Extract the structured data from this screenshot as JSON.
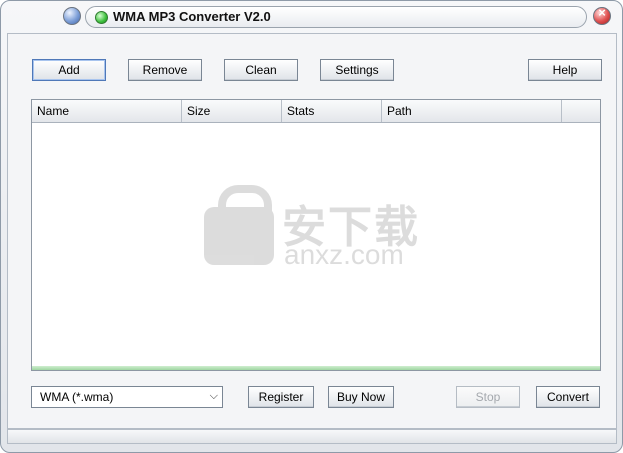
{
  "window": {
    "title": "WMA MP3 Converter V2.0"
  },
  "toolbar": {
    "add_label": "Add",
    "remove_label": "Remove",
    "clean_label": "Clean",
    "settings_label": "Settings",
    "help_label": "Help"
  },
  "file_list": {
    "columns": [
      "Name",
      "Size",
      "Stats",
      "Path"
    ],
    "rows": []
  },
  "watermark": {
    "cn_text": "安下载",
    "en_text": "anxz.com"
  },
  "format_select": {
    "selected": "WMA  (*.wma)"
  },
  "actions": {
    "register_label": "Register",
    "buy_label": "Buy Now",
    "stop_label": "Stop",
    "convert_label": "Convert"
  }
}
